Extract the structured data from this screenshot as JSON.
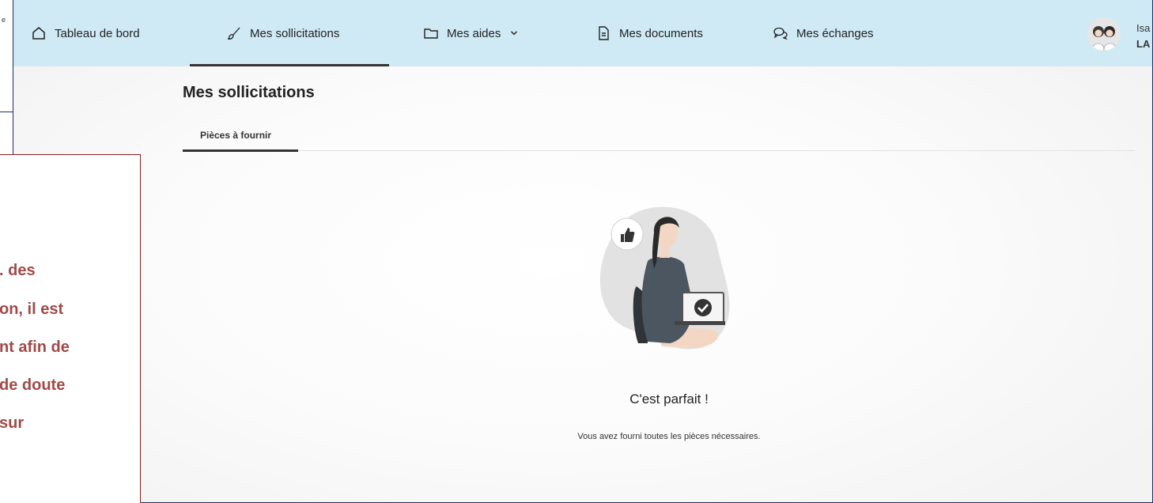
{
  "background_page": {
    "fragment_text": "e"
  },
  "nav": {
    "items": [
      {
        "label": "Tableau de bord",
        "icon": "home-icon"
      },
      {
        "label": "Mes sollicitations",
        "icon": "brush-icon",
        "active": true
      },
      {
        "label": "Mes aides",
        "icon": "folder-icon",
        "has_dropdown": true
      },
      {
        "label": "Mes documents",
        "icon": "document-icon"
      },
      {
        "label": "Mes échanges",
        "icon": "chat-bubbles-icon"
      }
    ]
  },
  "user": {
    "first_name": "Isa",
    "last_name": "LA"
  },
  "page": {
    "title": "Mes sollicitations",
    "tabs": [
      {
        "label": "Pièces à fournir",
        "active": true
      }
    ]
  },
  "empty_state": {
    "title": "C'est parfait !",
    "message": "Vous avez fourni toutes les pièces nécessaires."
  },
  "callout": {
    "lines": [
      ". des",
      "on, il est",
      "nt afin de",
      "de doute",
      "sur"
    ]
  },
  "colors": {
    "navbar_bg": "#cfeaf5",
    "callout_text": "#a04a48",
    "callout_border": "#8b1a1a",
    "frame_border": "#1f2d6b"
  }
}
